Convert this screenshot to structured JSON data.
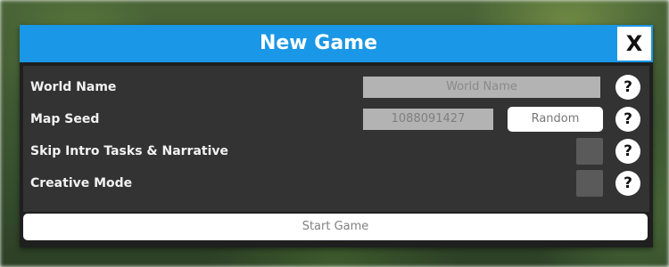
{
  "dialog": {
    "title": "New Game",
    "close_label": "X"
  },
  "rows": {
    "world_name": {
      "label": "World Name",
      "placeholder": "World Name",
      "value": ""
    },
    "map_seed": {
      "label": "Map Seed",
      "value": "1088091427",
      "random_label": "Random"
    },
    "skip_intro": {
      "label": "Skip Intro Tasks & Narrative",
      "checked": false
    },
    "creative_mode": {
      "label": "Creative Mode",
      "checked": false
    }
  },
  "help_label": "?",
  "start_label": "Start Game",
  "colors": {
    "titlebar": "#1a97e6",
    "panel": "#333333",
    "field": "#b3b3b3",
    "checkbox": "#5a5a5a"
  },
  "icons": {
    "help": "help-icon",
    "close": "close-icon"
  }
}
